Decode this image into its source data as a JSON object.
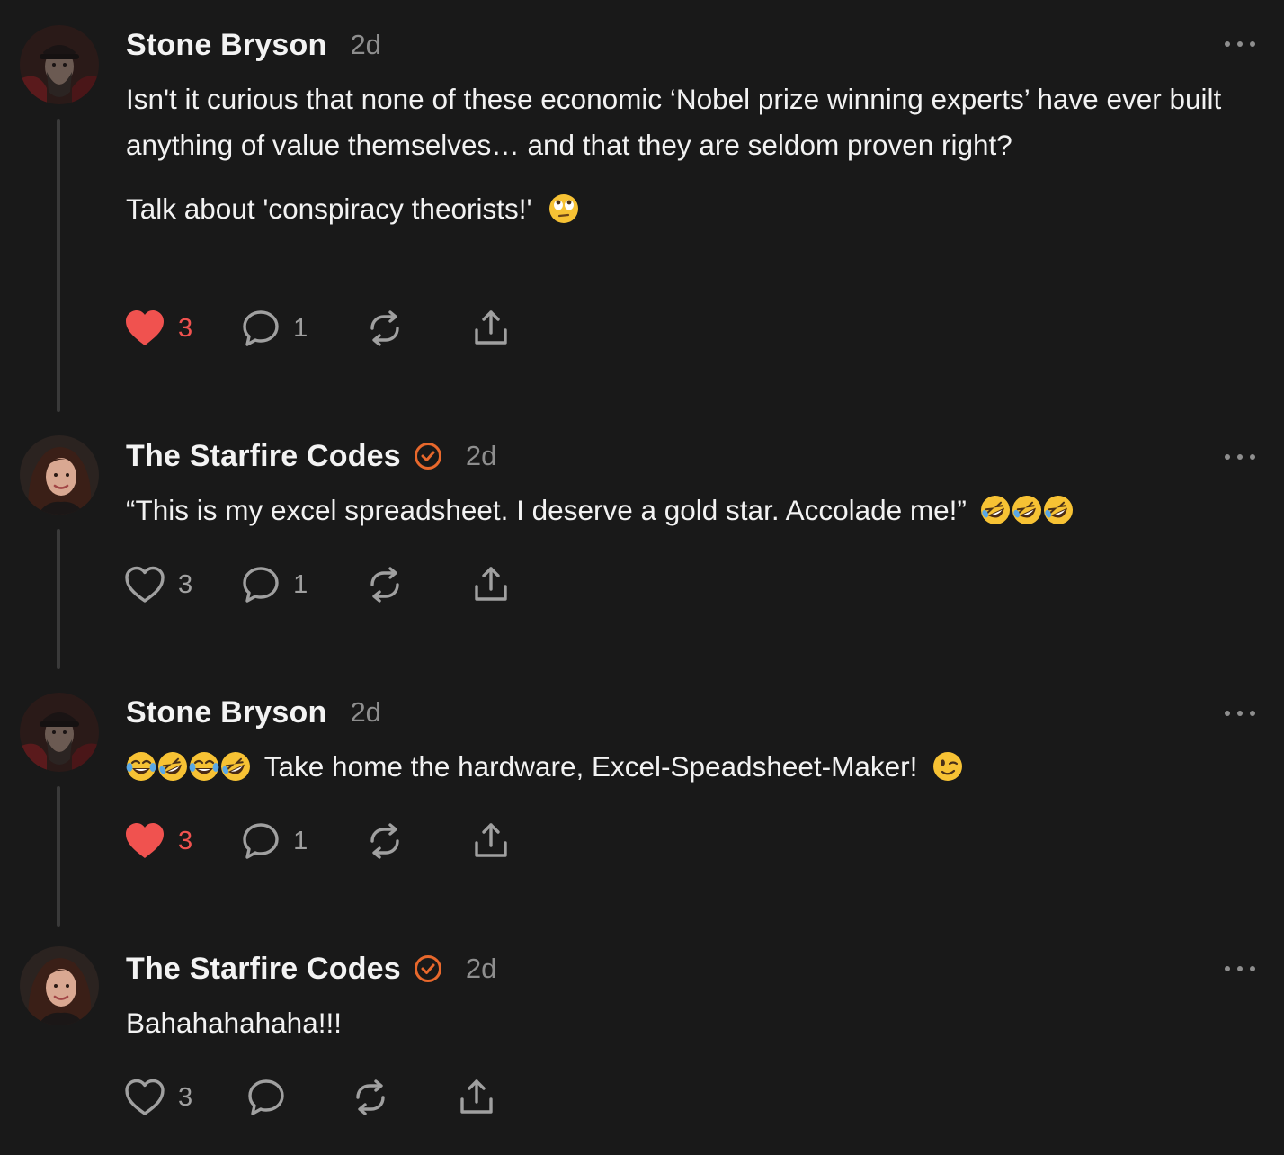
{
  "comments": [
    {
      "author": "Stone Bryson",
      "time": "2d",
      "verified": false,
      "paragraphs": [
        "Isn't it curious that none of these economic ‘Nobel prize winning experts’ have ever built anything of value themselves… and that they are seldom proven right?",
        "Talk about 'conspiracy theorists!'"
      ],
      "trailing_emoji": [
        "face-with-rolling-eyes"
      ],
      "leading_emoji": [],
      "likes": "3",
      "liked": true,
      "replies": "1"
    },
    {
      "author": "The Starfire Codes",
      "time": "2d",
      "verified": true,
      "paragraphs": [
        "“This is my excel spreadsheet. I deserve a gold star. Accolade me!”"
      ],
      "trailing_emoji": [
        "rolling-on-floor-laughing",
        "rolling-on-floor-laughing",
        "rolling-on-floor-laughing"
      ],
      "leading_emoji": [],
      "likes": "3",
      "liked": false,
      "replies": "1"
    },
    {
      "author": "Stone Bryson",
      "time": "2d",
      "verified": false,
      "paragraphs": [
        "Take home the hardware, Excel-Speadsheet-Maker!"
      ],
      "leading_emoji": [
        "face-with-tears-of-joy",
        "rolling-on-floor-laughing",
        "face-with-tears-of-joy",
        "rolling-on-floor-laughing"
      ],
      "trailing_emoji": [
        "winking-face"
      ],
      "likes": "3",
      "liked": true,
      "replies": "1"
    },
    {
      "author": "The Starfire Codes",
      "time": "2d",
      "verified": true,
      "paragraphs": [
        "Bahahahahaha!!!"
      ],
      "leading_emoji": [],
      "trailing_emoji": [],
      "likes": "3",
      "liked": false,
      "replies": ""
    }
  ],
  "icons": {
    "like": "heart-icon",
    "reply": "comment-icon",
    "repost": "repost-icon",
    "share": "share-icon",
    "more": "more-options-icon",
    "verified": "verified-badge-icon"
  },
  "colors": {
    "background": "#191919",
    "liked": "#f0524f",
    "verified": "#e8682c",
    "muted": "#8e8e8e"
  }
}
